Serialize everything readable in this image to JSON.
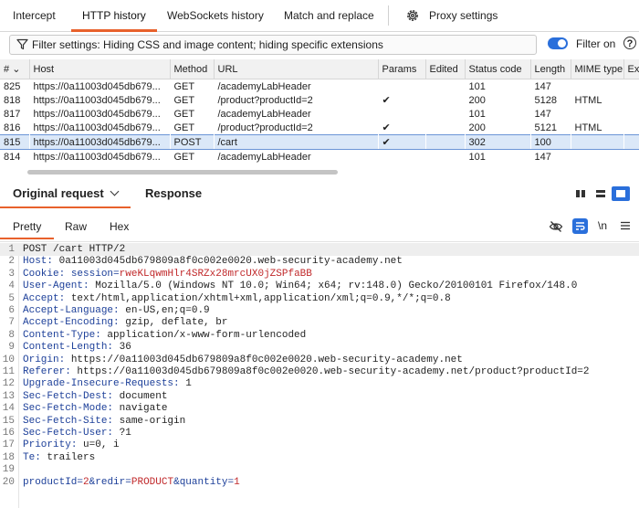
{
  "top_tabs": [
    "Intercept",
    "HTTP history",
    "WebSockets history",
    "Match and replace",
    "Proxy settings"
  ],
  "filter": {
    "text": "Filter settings: Hiding CSS and image content; hiding specific extensions",
    "toggle_label": "Filter on",
    "toggle_on": true,
    "help": "?"
  },
  "table": {
    "columns": [
      "#",
      "Host",
      "Method",
      "URL",
      "Params",
      "Edited",
      "Status code",
      "Length",
      "MIME type",
      "Ex"
    ],
    "sort_indicator": "⌄",
    "rows": [
      {
        "num": "825",
        "host": "https://0a11003d045db679...",
        "method": "GET",
        "url": "/academyLabHeader",
        "params": "",
        "edited": "",
        "status": "101",
        "length": "147",
        "mime": "",
        "selected": false
      },
      {
        "num": "818",
        "host": "https://0a11003d045db679...",
        "method": "GET",
        "url": "/product?productId=2",
        "params": "✔",
        "edited": "",
        "status": "200",
        "length": "5128",
        "mime": "HTML",
        "selected": false
      },
      {
        "num": "817",
        "host": "https://0a11003d045db679...",
        "method": "GET",
        "url": "/academyLabHeader",
        "params": "",
        "edited": "",
        "status": "101",
        "length": "147",
        "mime": "",
        "selected": false
      },
      {
        "num": "816",
        "host": "https://0a11003d045db679...",
        "method": "GET",
        "url": "/product?productId=2",
        "params": "✔",
        "edited": "",
        "status": "200",
        "length": "5121",
        "mime": "HTML",
        "selected": false
      },
      {
        "num": "815",
        "host": "https://0a11003d045db679...",
        "method": "POST",
        "url": "/cart",
        "params": "✔",
        "edited": "",
        "status": "302",
        "length": "100",
        "mime": "",
        "selected": true
      },
      {
        "num": "814",
        "host": "https://0a11003d045db679...",
        "method": "GET",
        "url": "/academyLabHeader",
        "params": "",
        "edited": "",
        "status": "101",
        "length": "147",
        "mime": "",
        "selected": false
      }
    ]
  },
  "editor": {
    "tabs": [
      "Original request",
      "Response"
    ],
    "subtabs": [
      "Pretty",
      "Raw",
      "Hex"
    ],
    "newline_label": "\\n"
  },
  "request": {
    "request_line": "POST /cart HTTP/2",
    "headers": [
      {
        "name": "Host",
        "value": "0a11003d045db679809a8f0c002e0020.web-security-academy.net"
      },
      {
        "name": "User-Agent",
        "value": "Mozilla/5.0 (Windows NT 10.0; Win64; x64; rv:148.0) Gecko/20100101 Firefox/148.0"
      },
      {
        "name": "Accept",
        "value": "text/html,application/xhtml+xml,application/xml;q=0.9,*/*;q=0.8"
      },
      {
        "name": "Accept-Language",
        "value": "en-US,en;q=0.9"
      },
      {
        "name": "Accept-Encoding",
        "value": "gzip, deflate, br"
      },
      {
        "name": "Content-Type",
        "value": "application/x-www-form-urlencoded"
      },
      {
        "name": "Content-Length",
        "value": "36"
      },
      {
        "name": "Origin",
        "value": "https://0a11003d045db679809a8f0c002e0020.web-security-academy.net"
      },
      {
        "name": "Referer",
        "value": "https://0a11003d045db679809a8f0c002e0020.web-security-academy.net/product?productId=2"
      },
      {
        "name": "Upgrade-Insecure-Requests",
        "value": "1"
      },
      {
        "name": "Sec-Fetch-Dest",
        "value": "document"
      },
      {
        "name": "Sec-Fetch-Mode",
        "value": "navigate"
      },
      {
        "name": "Sec-Fetch-Site",
        "value": "same-origin"
      },
      {
        "name": "Sec-Fetch-User",
        "value": "?1"
      },
      {
        "name": "Priority",
        "value": "u=0, i"
      },
      {
        "name": "Te",
        "value": "trailers"
      }
    ],
    "cookie": {
      "label": "Cookie",
      "name": "session",
      "value": "rweKLqwmHlr4SRZx28mrcUX0jZSPfaBB"
    },
    "body_params": [
      {
        "name": "productId",
        "value": "2"
      },
      {
        "name": "redir",
        "value": "PRODUCT"
      },
      {
        "name": "quantity",
        "value": "1"
      }
    ],
    "line_numbers": [
      "1",
      "2",
      "3",
      "4",
      "5",
      "6",
      "7",
      "8",
      "9",
      "10",
      "11",
      "12",
      "13",
      "14",
      "15",
      "16",
      "17",
      "18",
      "19",
      "20"
    ]
  },
  "colors": {
    "accent": "#e8612c",
    "toggle": "#2a6fdb",
    "header_name": "#1c3f99",
    "cookie_value": "#c0282a"
  }
}
